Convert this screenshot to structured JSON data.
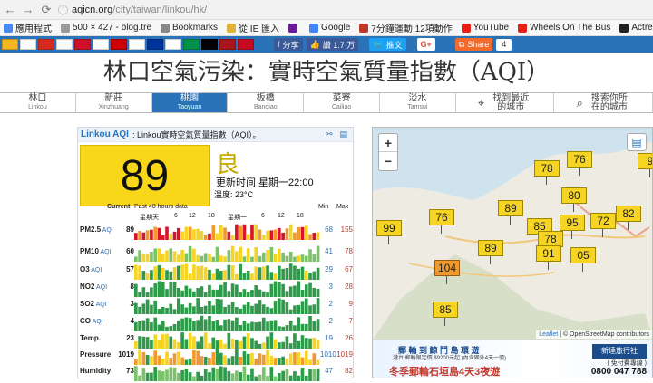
{
  "browser": {
    "url_host": "aqicn.org",
    "url_path": "/city/taiwan/linkou/hk/",
    "bookmarks": [
      {
        "label": "應用程式",
        "color": "#4a8af4"
      },
      {
        "label": "500 × 427 - blog.tre",
        "color": "#999999"
      },
      {
        "label": "Bookmarks",
        "color": "#888888"
      },
      {
        "label": "從 IE 匯入",
        "color": "#e0b43a"
      },
      {
        "label": "",
        "color": "#6a1b9a"
      },
      {
        "label": "Google",
        "color": "#4285f4"
      },
      {
        "label": "7分鐘運動 12項動作",
        "color": "#c0392b"
      },
      {
        "label": "YouTube",
        "color": "#e62117"
      },
      {
        "label": "Wheels On The Bus",
        "color": "#e62117"
      },
      {
        "label": "Actresses list",
        "color": "#222222"
      }
    ]
  },
  "flags": [
    "#f6b51e",
    "#ffffff",
    "#d52b1e",
    "#fbfbfb",
    "#ce1126",
    "#ffffff",
    "#cc0000",
    "#ffffff",
    "#003399",
    "#ffffff",
    "#009246",
    "#000000",
    "#aa151b",
    "#c60b1e"
  ],
  "social": {
    "share_label": "分享",
    "like_label": "讚 1.7 万",
    "tweet_label": "推文",
    "gplus_label": "G+",
    "share2_label": "Share",
    "share_count": "4"
  },
  "site_title": "林口空氣污染：實時空氣質量指數（AQI）",
  "city_tabs": [
    {
      "zh": "林口",
      "en": "Linkou",
      "active": false
    },
    {
      "zh": "新莊",
      "en": "Xinzhuang",
      "active": false
    },
    {
      "zh": "桃園",
      "en": "Taoyuan",
      "active": true
    },
    {
      "zh": "板橋",
      "en": "Banqiao",
      "active": false
    },
    {
      "zh": "菜寮",
      "en": "Cailiao",
      "active": false
    },
    {
      "zh": "淡水",
      "en": "Tamsui",
      "active": false
    },
    {
      "zh": "找到最近的城市",
      "en": "",
      "active": false
    },
    {
      "zh": "搜索你所在的城市",
      "en": "",
      "active": false
    }
  ],
  "card": {
    "city_label": "Linkou AQI",
    "subtitle": ": Linkou實時空氣質量指數（AQI）。",
    "aqi_value": "89",
    "aqi_level": "良",
    "update_text": "更新时间 星期一22:00",
    "temp_text": "温度: 23°C",
    "table_current": "Current",
    "table_past": "Past 48 hours data",
    "table_min": "Min",
    "table_max": "Max",
    "tick_labels": [
      "星期天",
      "6",
      "12",
      "18",
      "星期一",
      "6",
      "12",
      "18"
    ],
    "pollutants": [
      {
        "name": "PM2.5",
        "unit": "AQI",
        "value": "89",
        "min": "68",
        "max": "155"
      },
      {
        "name": "PM10",
        "unit": "AQI",
        "value": "60",
        "min": "41",
        "max": "78"
      },
      {
        "name": "O3",
        "unit": "AQI",
        "value": "57",
        "min": "29",
        "max": "67"
      },
      {
        "name": "NO2",
        "unit": "AQI",
        "value": "8",
        "min": "3",
        "max": "28"
      },
      {
        "name": "SO2",
        "unit": "AQI",
        "value": "3",
        "min": "2",
        "max": "9"
      },
      {
        "name": "CO",
        "unit": "AQI",
        "value": "4",
        "min": "2",
        "max": "7"
      },
      {
        "name": "Temp.",
        "unit": "",
        "value": "23",
        "min": "19",
        "max": "26"
      },
      {
        "name": "Pressure",
        "unit": "",
        "value": "1019",
        "min": "1010",
        "max": "1019"
      },
      {
        "name": "Humidity",
        "unit": "",
        "value": "73",
        "min": "47",
        "max": "82"
      }
    ]
  },
  "map": {
    "zoom_in": "+",
    "zoom_out": "−",
    "markers": [
      {
        "value": "78",
        "level": "moderate"
      },
      {
        "value": "76",
        "level": "moderate"
      },
      {
        "value": "9",
        "level": "moderate"
      },
      {
        "value": "80",
        "level": "moderate"
      },
      {
        "value": "89",
        "level": "moderate"
      },
      {
        "value": "76",
        "level": "moderate"
      },
      {
        "value": "85",
        "level": "moderate"
      },
      {
        "value": "95",
        "level": "moderate"
      },
      {
        "value": "72",
        "level": "moderate"
      },
      {
        "value": "82",
        "level": "moderate"
      },
      {
        "value": "99",
        "level": "moderate"
      },
      {
        "value": "78",
        "level": "moderate"
      },
      {
        "value": "89",
        "level": "moderate"
      },
      {
        "value": "91",
        "level": "moderate"
      },
      {
        "value": "05",
        "level": "moderate"
      },
      {
        "value": "104",
        "level": "sensitive"
      },
      {
        "value": "85",
        "level": "moderate"
      }
    ],
    "attribution_leaflet": "Leaflet",
    "attribution_rest": " | © OpenStreetMap contributors",
    "ad": {
      "line1": "郵 輪 到 鯨 鬥 島 環 遊",
      "line2": "港台 郵輪限定價 $9200元起 (內含國外4天一價)",
      "line3": "冬季郵輪石垣島4天3夜遊",
      "brand": "新達旅行社",
      "sub": "( 免付費專線 )",
      "phone": "0800 047 788"
    }
  }
}
